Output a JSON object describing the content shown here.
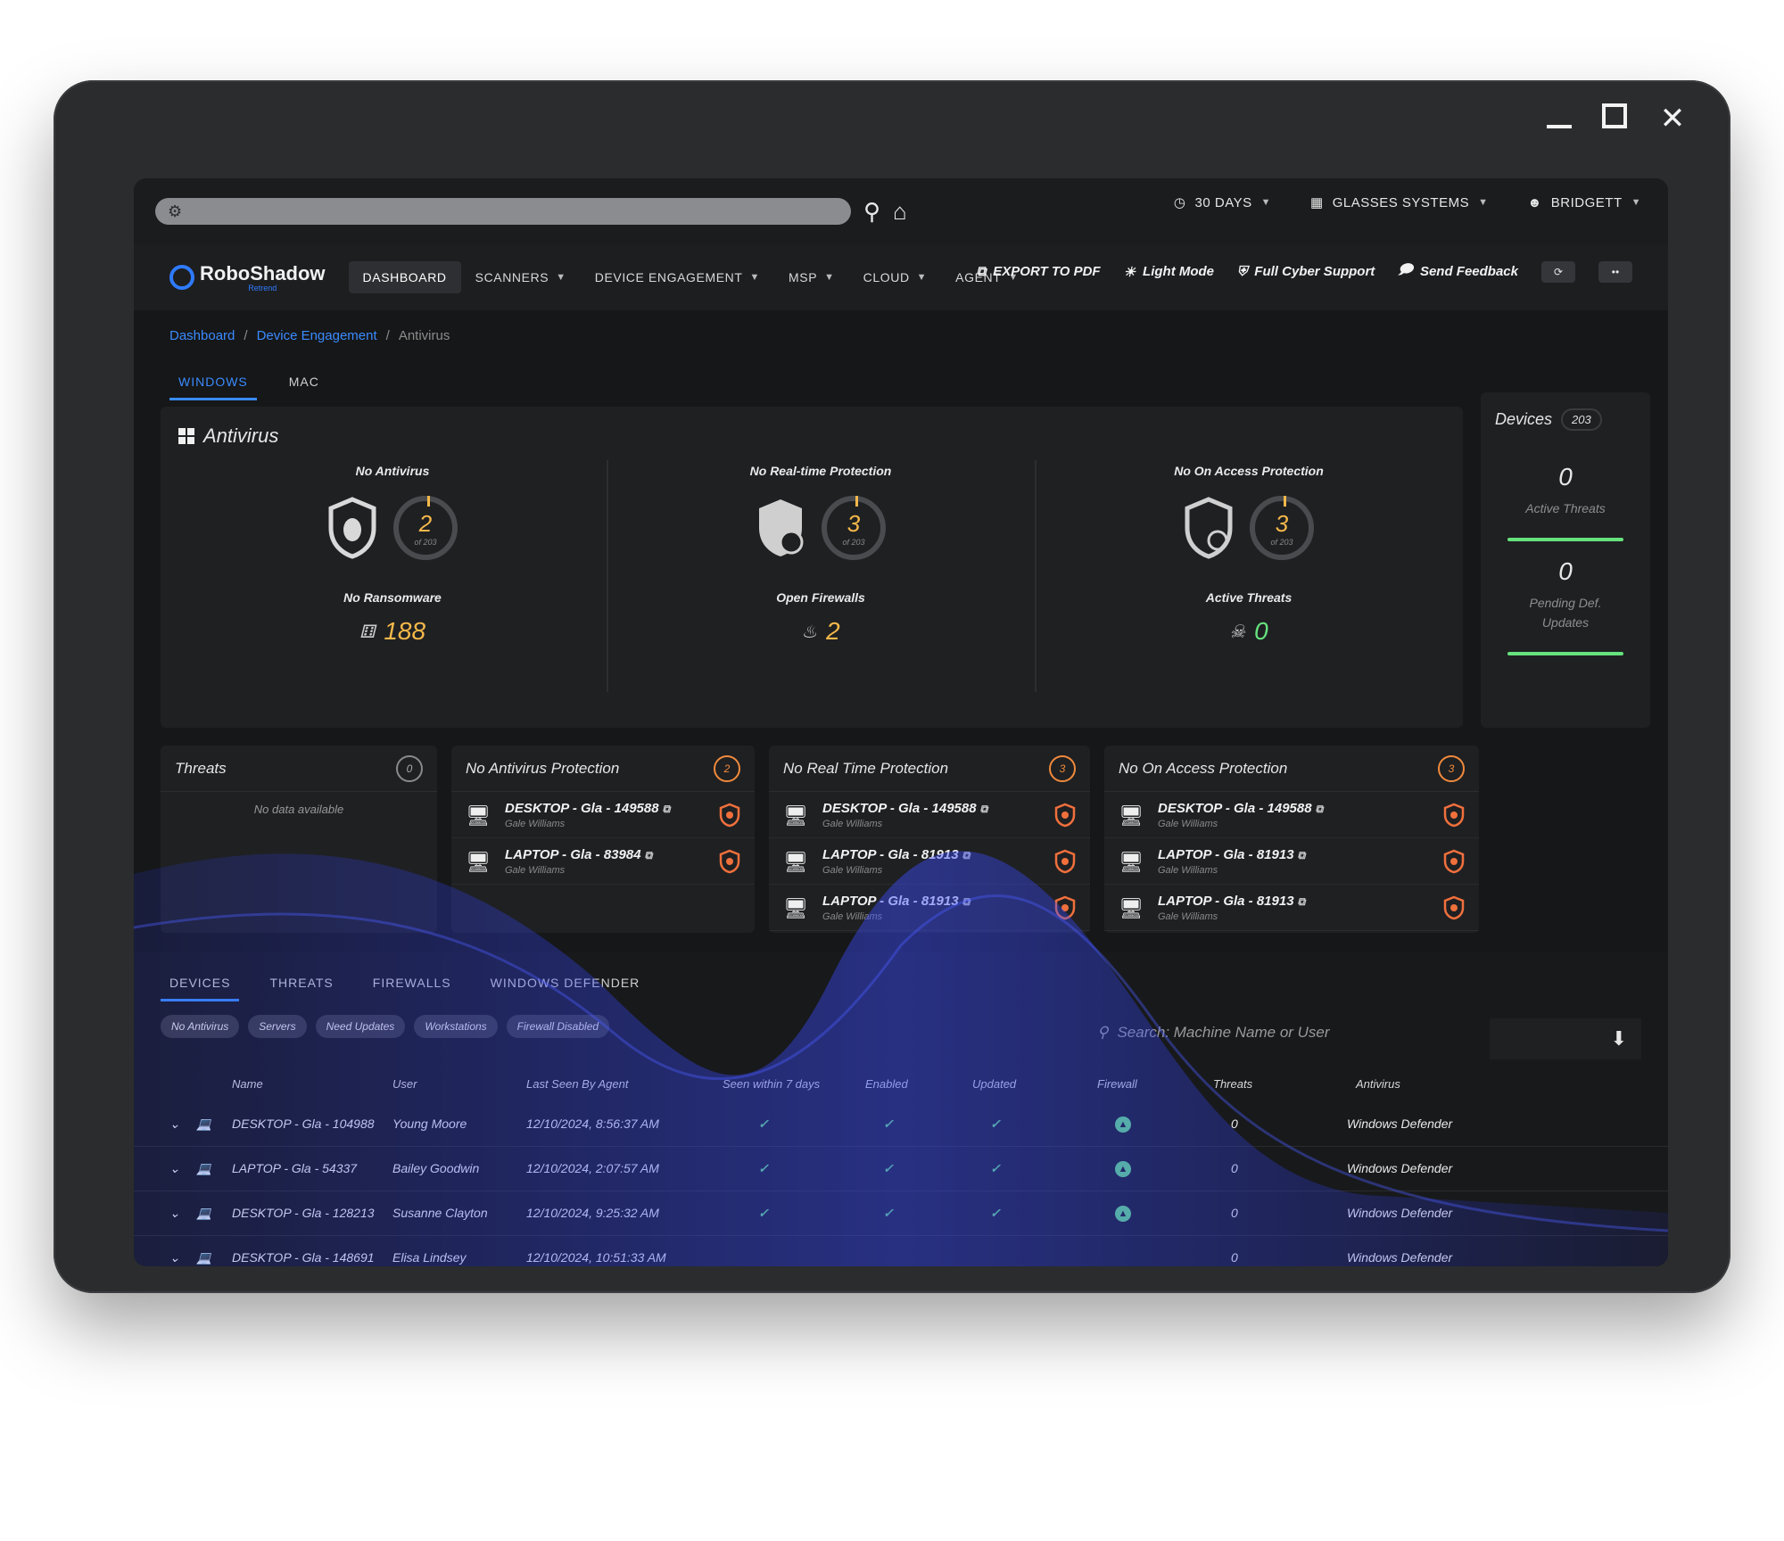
{
  "window": {
    "minimize": "_",
    "maximize": "☐",
    "close": "✕"
  },
  "browser": {
    "search_icon": "search-icon",
    "home_icon": "home-icon"
  },
  "top_right": {
    "period": "30 DAYS",
    "org": "GLASSES SYSTEMS",
    "user": "BRIDGETT"
  },
  "logo": {
    "name": "RoboShadow",
    "sub": "Retrend"
  },
  "nav": {
    "items": [
      "DASHBOARD",
      "SCANNERS",
      "DEVICE ENGAGEMENT",
      "MSP",
      "CLOUD",
      "AGENT"
    ],
    "actions": [
      "EXPORT TO PDF",
      "Light Mode",
      "Full Cyber Support",
      "Send Feedback"
    ],
    "mini1": "⟳",
    "mini2": "••"
  },
  "breadcrumb": {
    "a": "Dashboard",
    "b": "Device Engagement",
    "c": "Antivirus",
    "sep": "/"
  },
  "os_tabs": [
    "WINDOWS",
    "MAC"
  ],
  "antivirus": {
    "title": "Antivirus",
    "cols": [
      {
        "label": "No Antivirus",
        "value": "2",
        "of": "of 203",
        "sub_label": "No Ransomware",
        "sub_value": "188",
        "sub_icon": "spy-icon"
      },
      {
        "label": "No Real-time Protection",
        "value": "3",
        "of": "of 203",
        "sub_label": "Open Firewalls",
        "sub_value": "2",
        "sub_icon": "fire-icon"
      },
      {
        "label": "No On Access Protection",
        "value": "3",
        "of": "of 203",
        "sub_label": "Active Threats",
        "sub_value": "0",
        "sub_icon": "skull-icon"
      }
    ]
  },
  "devices_panel": {
    "title": "Devices",
    "count": "203",
    "stats": [
      {
        "value": "0",
        "label": "Active Threats"
      },
      {
        "value": "0",
        "label": "Pending Def. Updates"
      }
    ]
  },
  "cards": {
    "threats": {
      "title": "Threats",
      "count": "0",
      "empty": "No data available"
    },
    "no_antivirus": {
      "title": "No Antivirus Protection",
      "count": "2",
      "rows": [
        {
          "device": "DESKTOP - Gla - 149588",
          "user": "Gale Williams"
        },
        {
          "device": "LAPTOP - Gla - 83984",
          "user": "Gale Williams"
        }
      ]
    },
    "no_realtime": {
      "title": "No Real Time Protection",
      "count": "3",
      "rows": [
        {
          "device": "DESKTOP - Gla - 149588",
          "user": "Gale Williams"
        },
        {
          "device": "LAPTOP - Gla - 81913",
          "user": "Gale Williams"
        },
        {
          "device": "LAPTOP - Gla - 81913",
          "user": "Gale Williams"
        }
      ]
    },
    "no_access": {
      "title": "No On Access Protection",
      "count": "3",
      "rows": [
        {
          "device": "DESKTOP - Gla - 149588",
          "user": "Gale Williams"
        },
        {
          "device": "LAPTOP - Gla - 81913",
          "user": "Gale Williams"
        },
        {
          "device": "LAPTOP - Gla - 81913",
          "user": "Gale Williams"
        }
      ]
    }
  },
  "bottom": {
    "tabs": [
      "DEVICES",
      "THREATS",
      "FIREWALLS",
      "WINDOWS DEFENDER"
    ],
    "chips": [
      "No Antivirus",
      "Servers",
      "Need Updates",
      "Workstations",
      "Firewall Disabled"
    ],
    "search_placeholder": "Search: Machine Name or User",
    "columns": [
      "Name",
      "User",
      "Last Seen By Agent",
      "Seen within 7 days",
      "Enabled",
      "Updated",
      "Firewall",
      "Threats",
      "Antivirus"
    ],
    "rows": [
      {
        "name": "DESKTOP - Gla - 104988",
        "user": "Young Moore",
        "last_seen": "12/10/2024, 8:56:37 AM",
        "threats": "",
        "antivirus": ""
      },
      {
        "name": "LAPTOP - Gla - 54337",
        "user": "Bailey Goodwin",
        "last_seen": "12/10/2024, 2:07:57 AM",
        "threats": "0",
        "antivirus": "Windows Defender"
      },
      {
        "name": "DESKTOP - Gla - 128213",
        "user": "Susanne Clayton",
        "last_seen": "12/10/2024, 9:25:32 AM",
        "threats": "0",
        "antivirus": "Windows Defender"
      },
      {
        "name": "DESKTOP - Gla - 148691",
        "user": "Elisa Lindsey",
        "last_seen": "12/10/2024, 10:51:33 AM",
        "threats": "0",
        "antivirus": "Windows Defender"
      }
    ],
    "extra_antivirus": "Windows Defender",
    "extra_threats": "0",
    "check": "✓"
  },
  "colors": {
    "accent": "#3a8bff",
    "warning": "#f5b84a",
    "ok": "#66e27d",
    "alert": "#f08a3c"
  }
}
